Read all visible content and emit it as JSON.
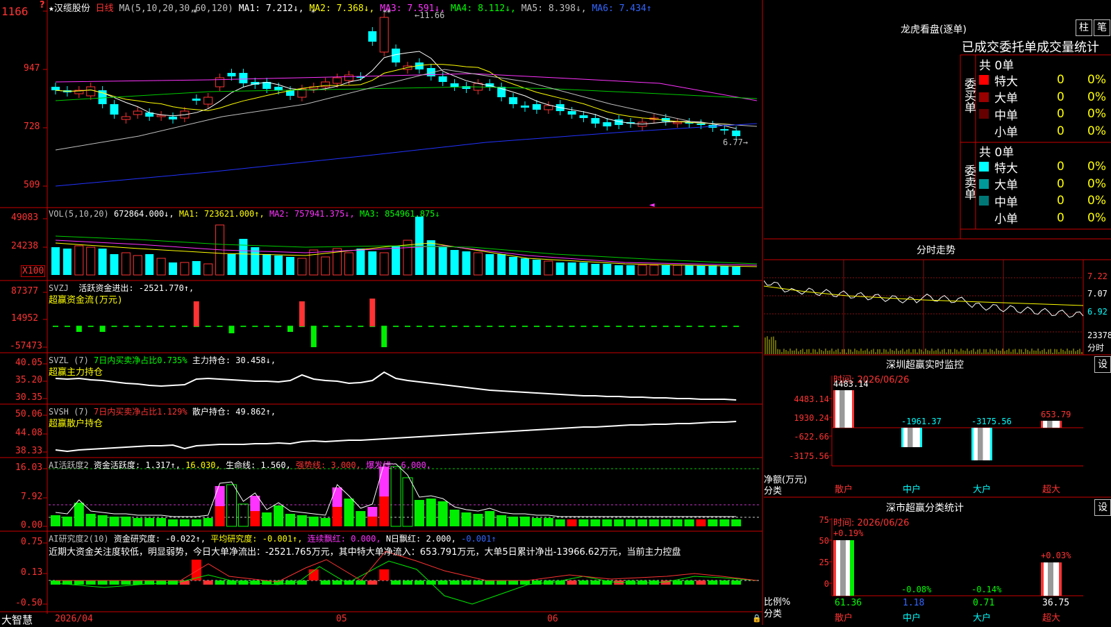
{
  "main": {
    "star": "★",
    "stock_name": "汉缆股份",
    "period": "日线",
    "ma_label": "MA(5,10,20,30,60,120)",
    "ma1": "MA1: 7.212↓,",
    "ma2": "MA2: 7.368↓,",
    "ma3": "MA3: 7.591↓,",
    "ma4": "MA4: 8.112↓,",
    "ma5": "MA5: 8.398↓,",
    "ma6": "MA6: 7.434↑",
    "y_ticks": [
      "1166",
      "947",
      "728",
      "509"
    ],
    "high_label": "11.66",
    "low_label": "6.77",
    "marker": "?"
  },
  "vol": {
    "label": "VOL(5,10,20)",
    "v": "672864.000↓,",
    "ma1": "MA1: 723621.000↑,",
    "ma2": "MA2: 757941.375↓,",
    "ma3": "MA3: 854961.875↓",
    "y_ticks": [
      "49083",
      "24238"
    ],
    "unit": "X100"
  },
  "svzj": {
    "label": "SVZJ",
    "text": "活跃资金进出: -2521.770↑,",
    "sub": "超赢资金流(万元)",
    "y_ticks": [
      "87377",
      "14952",
      "-57473"
    ]
  },
  "svzl": {
    "label": "SVZL (7)",
    "text1": "7日内买卖净占比0.735%",
    "text2": "主力持仓: 30.458↓,",
    "sub": "超赢主力持仓",
    "y_ticks": [
      "40.05",
      "35.20",
      "30.35"
    ]
  },
  "svsh": {
    "label": "SVSH (7)",
    "text1": "7日内买卖净占比1.129%",
    "text2": "散户持仓: 49.862↑,",
    "sub": "超赢散户持仓",
    "y_ticks": [
      "50.06",
      "44.08",
      "38.33"
    ]
  },
  "ai_active": {
    "label": "AI活跃度2",
    "t1": "资金活跃度: 1.317↑,",
    "t2": "16.030,",
    "t3": "生命线: 1.560,",
    "t4": "强势线: 3.000,",
    "t5": "爆发线: 6.000,",
    "y_ticks": [
      "16.03",
      "7.92",
      "0.00"
    ]
  },
  "ai_research": {
    "label": "AI研究度2(10)",
    "t1": "资金研究度: -0.022↑,",
    "t2": "平均研究度: -0.001↑,",
    "t3": "连续飘红: 0.000,",
    "t4": "N日飘红: 2.000,",
    "t5": "-0.001↑",
    "comment": "近期大资金关注度较低，明显弱势，今日大单净流出：-2521.765万元，其中特大单净流入：653.791万元，大单5日累计净出-13966.62万元，当前主力控盘",
    "y_ticks": [
      "0.75",
      "0.13",
      "-0.50"
    ]
  },
  "xaxis": {
    "d1": "2026/04",
    "d2": "05",
    "d3": "06"
  },
  "footer": {
    "brand": "大智慧"
  },
  "right": {
    "lhb_title": "龙虎看盘(逐单)",
    "btn_zhu": "柱",
    "btn_bi": "笔",
    "stats_title": "已成交委托单成交量统计",
    "buy_total": "共 0单",
    "sell_total": "共 0单",
    "buy_side": "委买单",
    "sell_side": "委卖单",
    "buy_rows": [
      {
        "name": "特大",
        "val": "0",
        "pct": "0%",
        "color": "#ff0000"
      },
      {
        "name": "大单",
        "val": "0",
        "pct": "0%",
        "color": "#990000"
      },
      {
        "name": "中单",
        "val": "0",
        "pct": "0%",
        "color": "#660000"
      },
      {
        "name": "小单",
        "val": "0",
        "pct": "0%",
        "color": "#000000"
      }
    ],
    "sell_rows": [
      {
        "name": "特大",
        "val": "0",
        "pct": "0%",
        "color": "#00ffff"
      },
      {
        "name": "大单",
        "val": "0",
        "pct": "0%",
        "color": "#009999"
      },
      {
        "name": "中单",
        "val": "0",
        "pct": "0%",
        "color": "#007777"
      },
      {
        "name": "小单",
        "val": "0",
        "pct": "0%",
        "color": "#000000"
      }
    ],
    "intraday_title": "分时走势",
    "intraday_ticks": [
      "7.22",
      "7.07",
      "6.92"
    ],
    "intraday_vol": "23378",
    "intraday_time_lbl": "分时",
    "sz_monitor_title": "深圳超赢实时监控",
    "btn_set": "设",
    "sz_time": "时间: 2026/06/26",
    "sz_ticks": [
      "4483.14",
      "1930.24",
      "-622.66",
      "-3175.56"
    ],
    "sz_bar_labels": [
      "4483.14",
      "-1961.37",
      "-3175.56",
      "653.79"
    ],
    "sz_ylabel": "净额(万元)",
    "cat_label": "分类",
    "cats": [
      "散户",
      "中户",
      "大户",
      "超大"
    ],
    "cls_title": "深市超赢分类统计",
    "cls_time": "时间: 2026/06/26",
    "cls_ticks": [
      "75",
      "50",
      "25",
      "0"
    ],
    "cls_pct": [
      "+0.19%",
      "-0.08%",
      "-0.14%",
      "+0.03%"
    ],
    "cls_vals": [
      "61.36",
      "1.18",
      "0.71",
      "36.75"
    ],
    "cls_ylabel": "比例%"
  }
}
